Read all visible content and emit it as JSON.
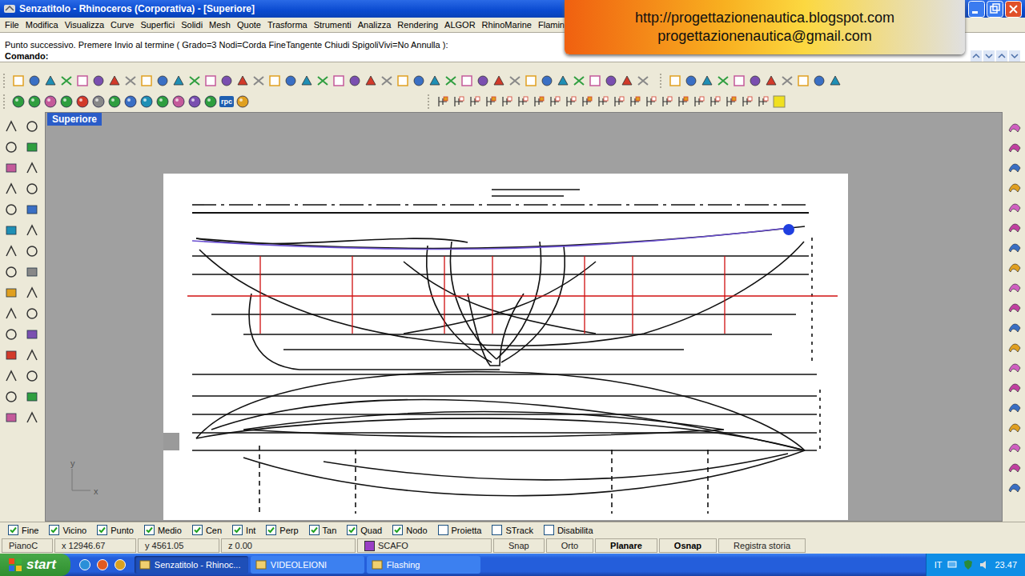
{
  "window": {
    "title": "Senzatitolo - Rhinoceros (Corporativa) - [Superiore]"
  },
  "banner": {
    "lines": [
      "http://progettazionenautica.blogspot.com",
      "progettazionenautica@gmail.com"
    ]
  },
  "menu": [
    "File",
    "Modifica",
    "Visualizza",
    "Curve",
    "Superfici",
    "Solidi",
    "Mesh",
    "Quote",
    "Trasforma",
    "Strumenti",
    "Analizza",
    "Rendering",
    "ALGOR",
    "RhinoMarine",
    "Flamingo"
  ],
  "command": {
    "history": "Punto successivo. Premere Invio al termine ( Grado=3  Nodi=Corda  FineTangente  Chiudi  SpigoliVivi=No  Annulla ):",
    "prompt": "Comando:",
    "value": ""
  },
  "toolbar2": {
    "label": "rpc"
  },
  "viewport": {
    "tab": "Superiore",
    "axes": {
      "x": "x",
      "y": "y"
    }
  },
  "osnap": [
    {
      "label": "Fine",
      "checked": true
    },
    {
      "label": "Vicino",
      "checked": true
    },
    {
      "label": "Punto",
      "checked": true
    },
    {
      "label": "Medio",
      "checked": true
    },
    {
      "label": "Cen",
      "checked": true
    },
    {
      "label": "Int",
      "checked": true
    },
    {
      "label": "Perp",
      "checked": true
    },
    {
      "label": "Tan",
      "checked": true
    },
    {
      "label": "Quad",
      "checked": true
    },
    {
      "label": "Nodo",
      "checked": true
    },
    {
      "label": "Proietta",
      "checked": false
    },
    {
      "label": "STrack",
      "checked": false
    },
    {
      "label": "Disabilita",
      "checked": false
    }
  ],
  "status_bar": {
    "plane": "PianoC",
    "x": "x 12946.67",
    "y": "y 4561.05",
    "z": "z 0.00",
    "layer": {
      "name": "SCAFO",
      "color": "#9a3fc4"
    },
    "toggles": [
      {
        "label": "Snap",
        "on": false
      },
      {
        "label": "Orto",
        "on": false
      },
      {
        "label": "Planare",
        "on": true
      },
      {
        "label": "Osnap",
        "on": true
      },
      {
        "label": "Registra storia",
        "on": false
      }
    ]
  },
  "taskbar": {
    "start": "start",
    "tasks": [
      {
        "label": "Senzatitolo - Rhinoc...",
        "selected": true
      },
      {
        "label": "VIDEOLEIONI",
        "selected": false
      },
      {
        "label": "Flashing",
        "selected": false
      }
    ],
    "language": "IT",
    "time": "23.47"
  }
}
